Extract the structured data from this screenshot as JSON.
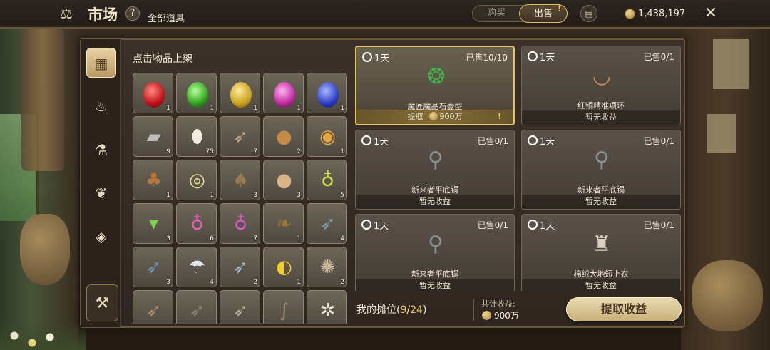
{
  "header": {
    "title": "市场",
    "subtitle": "全部道具",
    "help": "?",
    "tabs": {
      "buy": "购买",
      "sell": "出售",
      "sell_badge": "!"
    },
    "coins": "1,438,197"
  },
  "inventory": {
    "title": "点击物品上架",
    "items": [
      {
        "icon": "red-gem",
        "qty": "1"
      },
      {
        "icon": "green-gem",
        "qty": "1"
      },
      {
        "icon": "yellow-gem",
        "qty": "1"
      },
      {
        "icon": "pink-gem",
        "qty": "1"
      },
      {
        "icon": "blue-gem",
        "qty": "1"
      },
      {
        "icon": "stone-brick",
        "qty": "9"
      },
      {
        "icon": "egg",
        "qty": "75"
      },
      {
        "icon": "dried-fish",
        "qty": "7"
      },
      {
        "icon": "bread",
        "qty": "2"
      },
      {
        "icon": "pancake",
        "qty": "1"
      },
      {
        "icon": "roast-meat",
        "qty": "1"
      },
      {
        "icon": "soup-bowl",
        "qty": "1"
      },
      {
        "icon": "water-pouch",
        "qty": "3"
      },
      {
        "icon": "flatbread",
        "qty": "3"
      },
      {
        "icon": "yellow-potion",
        "qty": "5"
      },
      {
        "icon": "green-drink",
        "qty": "3"
      },
      {
        "icon": "pink-potion",
        "qty": "6"
      },
      {
        "icon": "magenta-potion",
        "qty": "7"
      },
      {
        "icon": "leaf",
        "qty": "1"
      },
      {
        "icon": "blue-fish",
        "qty": "4"
      },
      {
        "icon": "blue-fish-2",
        "qty": "3"
      },
      {
        "icon": "jellyfish",
        "qty": "4"
      },
      {
        "icon": "silver-fish",
        "qty": "2"
      },
      {
        "icon": "yellow-tropical-fish",
        "qty": "1"
      },
      {
        "icon": "crab",
        "qty": "2"
      },
      {
        "icon": "trout",
        "qty": ""
      },
      {
        "icon": "catfish",
        "qty": ""
      },
      {
        "icon": "pike",
        "qty": ""
      },
      {
        "icon": "eel",
        "qty": ""
      },
      {
        "icon": "white-coral",
        "qty": ""
      }
    ]
  },
  "listings": [
    {
      "duration": "1天",
      "sold": "已售10/10",
      "name": "魔匠魔晶石壹型",
      "status": "提取",
      "earnings": "900万",
      "highlight": true,
      "icon": "crystal"
    },
    {
      "duration": "1天",
      "sold": "已售0/1",
      "name": "红铜精准项环",
      "status": "暂无收益",
      "highlight": false,
      "icon": "copper-ring"
    },
    {
      "duration": "1天",
      "sold": "已售0/1",
      "name": "新来者平底锅",
      "status": "暂无收益",
      "highlight": false,
      "icon": "frying-pan"
    },
    {
      "duration": "1天",
      "sold": "已售0/1",
      "name": "新来者平底锅",
      "status": "暂无收益",
      "highlight": false,
      "icon": "frying-pan"
    },
    {
      "duration": "1天",
      "sold": "已售0/1",
      "name": "新来者平底锅",
      "status": "暂无收益",
      "highlight": false,
      "icon": "frying-pan"
    },
    {
      "duration": "1天",
      "sold": "已售0/1",
      "name": "棉绒大地短上衣",
      "status": "暂无收益",
      "highlight": false,
      "icon": "tunic"
    }
  ],
  "footer": {
    "stall_prefix": "我的摊位(",
    "stall_used": "9",
    "stall_sep": "/",
    "stall_total": "24",
    "stall_suffix": ")",
    "earnings_label": "共计收益:",
    "earnings_value": "900万",
    "collect_button": "提取收益"
  }
}
